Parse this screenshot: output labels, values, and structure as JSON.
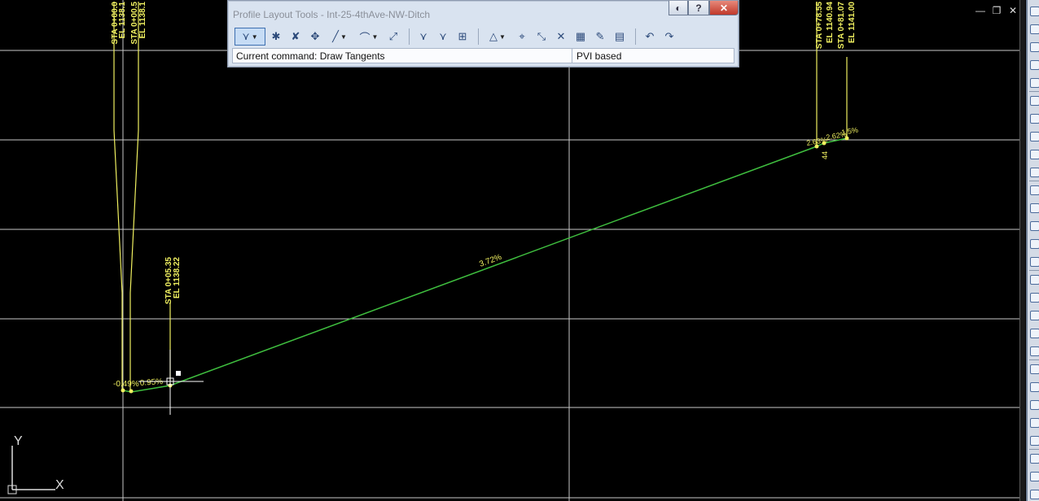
{
  "toolbar": {
    "title": "Profile Layout Tools - Int-25-4thAve-NW-Ditch",
    "help_label": "?",
    "close_label": "✕",
    "current_command": "Current command: Draw Tangents",
    "mode": "PVI based",
    "tools": [
      {
        "icon": "draw-tangents-icon",
        "glyph": "⋎",
        "active": true,
        "dropdown": true
      },
      {
        "icon": "insert-pvi-icon",
        "glyph": "✱"
      },
      {
        "icon": "delete-pvi-icon",
        "glyph": "✘"
      },
      {
        "icon": "move-pvi-icon",
        "glyph": "✥"
      },
      {
        "icon": "fixed-line-icon",
        "glyph": "╱",
        "dropdown": true
      },
      {
        "icon": "fixed-curve-icon",
        "glyph": "⌒",
        "dropdown": true
      },
      {
        "icon": "free-vertical-curve-icon",
        "glyph": "⤢"
      },
      {
        "sep": true
      },
      {
        "icon": "insert-pvis-tabular-icon",
        "glyph": "⋎"
      },
      {
        "icon": "raise-lower-pvis-icon",
        "glyph": "⋎"
      },
      {
        "icon": "copy-profile-icon",
        "glyph": "⊞"
      },
      {
        "sep": true
      },
      {
        "icon": "convert-icon",
        "glyph": "△",
        "dropdown": true
      },
      {
        "icon": "select-pvi-icon",
        "glyph": "⌖"
      },
      {
        "icon": "delete-entity-icon",
        "glyph": "⤡"
      },
      {
        "icon": "delete-pvi-tool-icon",
        "glyph": "✕"
      },
      {
        "icon": "profile-grid-view-icon",
        "glyph": "▦"
      },
      {
        "icon": "profile-layout-parameters-icon",
        "glyph": "✎"
      },
      {
        "icon": "profile-grid-icon",
        "glyph": "▤"
      },
      {
        "sep": true
      },
      {
        "icon": "undo-icon",
        "glyph": "↶"
      },
      {
        "icon": "redo-icon",
        "glyph": "↷"
      }
    ]
  },
  "profile": {
    "colors": {
      "background": "#000000",
      "grid": "#c8c8c8",
      "label": "#f0f060",
      "tangent": "#3fbf3f",
      "crosshair": "#ffffff"
    },
    "pvi_labels": [
      {
        "sta": "STA 0+00.0",
        "el": "EL 1138.1"
      },
      {
        "sta": "STA 0+00.5",
        "el": "EL 1138.1"
      },
      {
        "sta": "STA 0+05.35",
        "el": "EL 1138.22"
      },
      {
        "sta": "STA 0+78.55",
        "el": "EL 1140.94"
      },
      {
        "sta": "STA 0+81.07",
        "el": "EL 1141.00"
      }
    ],
    "grade_labels": [
      "-0.49%",
      "0.95%",
      "3.72%",
      "2.63%",
      "2.62%",
      "1.5%",
      "44"
    ],
    "ucs": {
      "x": "X",
      "y": "Y"
    }
  },
  "window_controls": {
    "minimize": "—",
    "restore": "❐",
    "close": "✕"
  }
}
